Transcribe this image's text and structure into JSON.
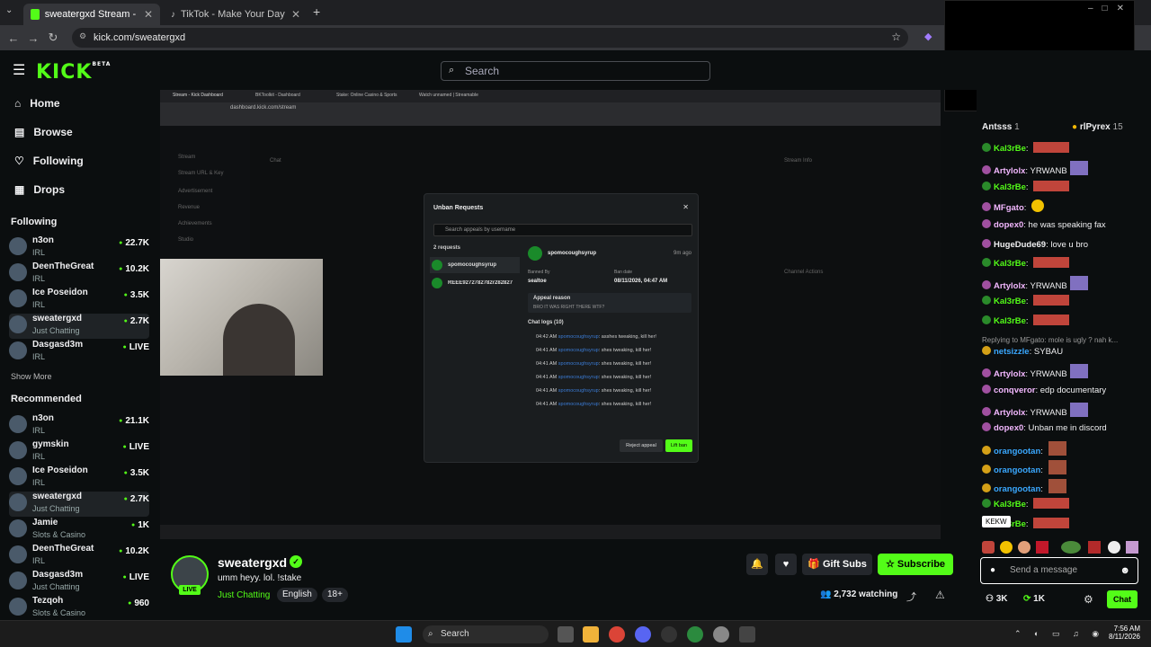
{
  "browser": {
    "tabs": [
      {
        "title": "sweatergxd Stream - Watc"
      },
      {
        "title": "TikTok - Make Your Day"
      }
    ],
    "new_tab": "+",
    "url": "kick.com/sweatergxd"
  },
  "header": {
    "logo": "KICK",
    "logo_sup": "BETA",
    "search_placeholder": "Search"
  },
  "sidebar": {
    "nav": [
      {
        "label": "Home",
        "icon": "home-icon"
      },
      {
        "label": "Browse",
        "icon": "compass-icon"
      },
      {
        "label": "Following",
        "icon": "heart-icon"
      },
      {
        "label": "Drops",
        "icon": "drops-icon"
      }
    ],
    "following_title": "Following",
    "following": [
      {
        "name": "n3on",
        "sub": "IRL",
        "viewers": "22.7K"
      },
      {
        "name": "DeenTheGreat",
        "sub": "IRL",
        "viewers": "10.2K"
      },
      {
        "name": "Ice Poseidon",
        "sub": "IRL",
        "viewers": "3.5K"
      },
      {
        "name": "sweatergxd",
        "sub": "Just Chatting",
        "viewers": "2.7K"
      },
      {
        "name": "Dasgasd3m",
        "sub": "IRL",
        "viewers": "LIVE"
      }
    ],
    "show_more": "Show More",
    "recommended_title": "Recommended",
    "recommended": [
      {
        "name": "n3on",
        "sub": "IRL",
        "viewers": "21.1K"
      },
      {
        "name": "gymskin",
        "sub": "IRL",
        "viewers": "LIVE"
      },
      {
        "name": "Ice Poseidon",
        "sub": "IRL",
        "viewers": "3.5K"
      },
      {
        "name": "sweatergxd",
        "sub": "Just Chatting",
        "viewers": "2.7K"
      },
      {
        "name": "Jamie",
        "sub": "Slots & Casino",
        "viewers": "1K"
      },
      {
        "name": "DeenTheGreat",
        "sub": "IRL",
        "viewers": "10.2K"
      },
      {
        "name": "Dasgasd3m",
        "sub": "Just Chatting",
        "viewers": "LIVE"
      },
      {
        "name": "Tezqoh",
        "sub": "Slots & Casino",
        "viewers": "960"
      }
    ]
  },
  "stream_inner": {
    "tabs": [
      "Stream - Kick Dashboard",
      "BKToolkit - Dashboard",
      "Stake: Online Casino & Sports",
      "Watch unnamed | Streamable"
    ],
    "url": "dashboard.kick.com/stream",
    "sidebar_items": [
      "Stream",
      "Stream URL & Key",
      "Advertisement",
      "Revenue",
      "Achievements",
      "Studio"
    ],
    "panel_chat": "Chat",
    "panel_info": "Stream Info",
    "panel_actions": "Channel Actions",
    "modal": {
      "title": "Unban Requests",
      "search_placeholder": "Search appeals by username",
      "count": "2 requests",
      "requests": [
        "spomocoughsyrup",
        "REEE9272782782r282827"
      ],
      "user": "spomocoughsyrup",
      "time_ago": "9m ago",
      "banned_by_label": "Banned By",
      "banned_by": "sealtoe",
      "ban_date_label": "Ban date",
      "ban_date": "08/11/2026, 04:47 AM",
      "appeal_label": "Appeal reason",
      "appeal": "BRO IT WAS RIGHT THERE WTF?",
      "chat_logs_label": "Chat logs (10)",
      "logs": [
        {
          "time": "04:42 AM",
          "user": "spomocoughsyrup",
          "msg": ": asshes tweaking, kill her!"
        },
        {
          "time": "04:41 AM",
          "user": "spomocoughsyrup",
          "msg": ": shes tweaking, kill her!"
        },
        {
          "time": "04:41 AM",
          "user": "spomocoughsyrup",
          "msg": ": shes tweaking, kill her!"
        },
        {
          "time": "04:41 AM",
          "user": "spomocoughsyrup",
          "msg": ": shes tweaking, kill her!"
        },
        {
          "time": "04:41 AM",
          "user": "spomocoughsyrup",
          "msg": ": shes tweaking, kill her!"
        },
        {
          "time": "04:41 AM",
          "user": "spomocoughsyrup",
          "msg": ": shes tweaking, kill her!"
        }
      ],
      "reject_label": "Reject appeal",
      "lift_label": "Lift ban"
    }
  },
  "info": {
    "channel": "sweatergxd",
    "live": "LIVE",
    "title": "umm heyy. lol. !stake",
    "category": "Just Chatting",
    "tags": [
      "English",
      "18+"
    ],
    "gift": "Gift Subs",
    "subscribe": "Subscribe",
    "watching": "2,732 watching"
  },
  "chat": {
    "header_left": "Antsss",
    "header_left_count": "1",
    "header_right": "rlPyrex",
    "header_right_count": "15",
    "messages": [
      {
        "user": "Kal3rBe",
        "color": "#53fc18",
        "text": "",
        "emote": true
      },
      {
        "user": "Artylolx",
        "color": "#f3b8ff",
        "text": "YRWANB",
        "emote2": true
      },
      {
        "user": "Kal3rBe",
        "color": "#53fc18",
        "text": "",
        "emote": true
      },
      {
        "user": "MFgato",
        "color": "#f3b8ff",
        "text": "",
        "emote3": true
      },
      {
        "user": "dopex0",
        "color": "#f3b8ff",
        "text": "he was speaking fax"
      },
      {
        "user": "HugeDude69",
        "color": "#efeff1",
        "text": "love u bro"
      },
      {
        "user": "Kal3rBe",
        "color": "#53fc18",
        "text": "",
        "emote": true
      },
      {
        "user": "Artylolx",
        "color": "#f3b8ff",
        "text": "YRWANB",
        "emote2": true
      },
      {
        "user": "Kal3rBe",
        "color": "#53fc18",
        "text": "",
        "emote": true
      },
      {
        "user": "Kal3rBe",
        "color": "#53fc18",
        "text": "",
        "emote": true
      },
      {
        "user": "netsizzle",
        "color": "#3aa8ff",
        "text": "SYBAU",
        "reply": "Replying to MFgato: mole is ugly ? nah k..."
      },
      {
        "user": "Artylolx",
        "color": "#f3b8ff",
        "text": "YRWANB",
        "emote2": true
      },
      {
        "user": "conqveror",
        "color": "#f3b8ff",
        "text": "edp documentary"
      },
      {
        "user": "Artylolx",
        "color": "#f3b8ff",
        "text": "YRWANB",
        "emote2": true
      },
      {
        "user": "dopex0",
        "color": "#f3b8ff",
        "text": "Unban me in discord"
      },
      {
        "user": "orangootan",
        "color": "#3aa8ff",
        "text": "",
        "emote4": true
      },
      {
        "user": "orangootan",
        "color": "#3aa8ff",
        "text": "",
        "emote4": true
      },
      {
        "user": "orangootan",
        "color": "#3aa8ff",
        "text": "",
        "emote4": true
      },
      {
        "user": "Kal3rBe",
        "color": "#53fc18",
        "text": "",
        "emote": true
      },
      {
        "user": "Kal3rBe",
        "color": "#53fc18",
        "text": "",
        "emote": true
      }
    ],
    "tooltip": "KEKW",
    "input_placeholder": "Send a message",
    "stat1": "3K",
    "stat2": "1K",
    "chat_button": "Chat"
  },
  "taskbar": {
    "search": "Search",
    "time": "7:56 AM",
    "date": "8/11/2026"
  }
}
